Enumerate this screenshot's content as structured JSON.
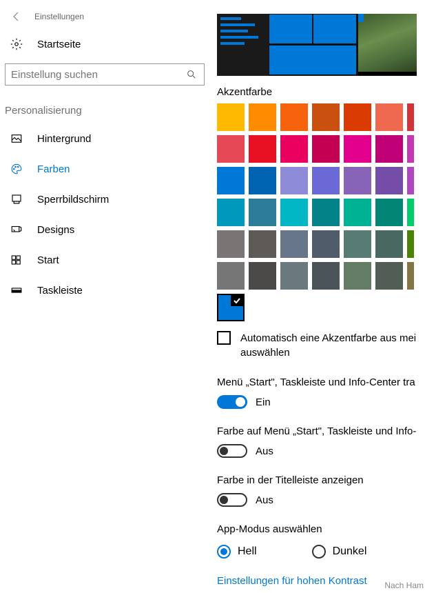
{
  "header": {
    "page_title": "Einstellungen"
  },
  "home": {
    "label": "Startseite"
  },
  "search": {
    "placeholder": "Einstellung suchen"
  },
  "section": {
    "label": "Personalisierung"
  },
  "nav": {
    "items": [
      {
        "label": "Hintergrund"
      },
      {
        "label": "Farben"
      },
      {
        "label": "Sperrbildschirm"
      },
      {
        "label": "Designs"
      },
      {
        "label": "Start"
      },
      {
        "label": "Taskleiste"
      }
    ]
  },
  "accent": {
    "label": "Akzentfarbe",
    "colors": [
      "#ffb900",
      "#ff8c00",
      "#f7630c",
      "#ca5010",
      "#da3b01",
      "#ef6950",
      "#d1",
      "#e74856",
      "#e81123",
      "#ea005e",
      "#c30052",
      "#e3008c",
      "#bf0077",
      "#c2",
      "#0078d7",
      "#0063b1",
      "#8e8cd8",
      "#6b69d6",
      "#8764b8",
      "#744da9",
      "#b1",
      "#0099bc",
      "#2d7d9a",
      "#00b7c3",
      "#038387",
      "#00b294",
      "#018574",
      "#00",
      "#7a7574",
      "#5d5a58",
      "#68768a",
      "#515c6b",
      "#567c73",
      "#486860",
      "#49",
      "#767676",
      "#4c4a48",
      "#69797e",
      "#4a5459",
      "#647c64",
      "#525e54",
      "#84"
    ],
    "selected_color": "#0078d7",
    "auto_checkbox_label": "Automatisch eine Akzentfarbe aus meinem Hintergrund auswählen",
    "auto_checkbox_label_visible": "Automatisch eine Akzentfarbe aus mei auswählen"
  },
  "settings": {
    "transparency": {
      "title": "Menü „Start\", Taskleiste und Info-Center tra",
      "state": "Ein"
    },
    "accent_surfaces": {
      "title": "Farbe auf Menü „Start\", Taskleiste und Info-",
      "state": "Aus"
    },
    "titlebar": {
      "title": "Farbe in der Titelleiste anzeigen",
      "state": "Aus"
    },
    "app_mode": {
      "title": "App-Modus auswählen",
      "light": "Hell",
      "dark": "Dunkel"
    }
  },
  "link": {
    "label": "Einstellungen für hohen Kontrast"
  },
  "overlay": {
    "text": "Nach Ham"
  }
}
